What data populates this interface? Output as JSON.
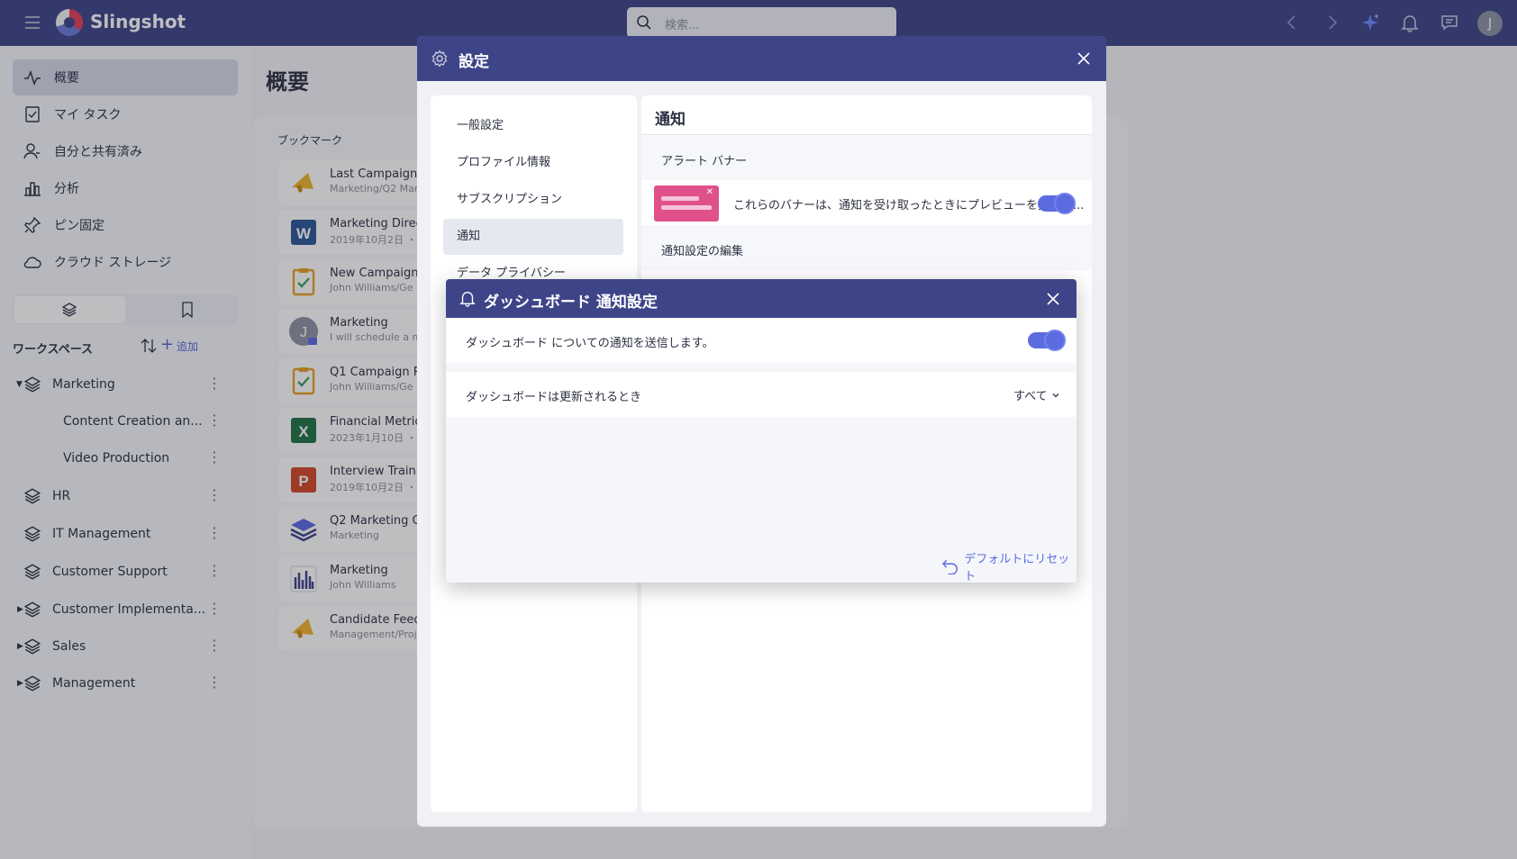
{
  "app": {
    "name": "Slingshot",
    "avatar_initial": "J"
  },
  "search": {
    "placeholder": "検索..."
  },
  "sidebar": {
    "nav": [
      {
        "label": "概要",
        "icon": "activity-icon",
        "active": true
      },
      {
        "label": "マイ タスク",
        "icon": "task-icon"
      },
      {
        "label": "自分と共有済み",
        "icon": "shared-user-icon"
      },
      {
        "label": "分析",
        "icon": "bar-chart-icon"
      },
      {
        "label": "ピン固定",
        "icon": "pin-icon"
      },
      {
        "label": "クラウド ストレージ",
        "icon": "cloud-icon"
      }
    ],
    "workspace_title": "ワークスペース",
    "add_label": "追加",
    "workspaces": [
      {
        "label": "Marketing",
        "expanded": true
      },
      {
        "label": "Content Creation an...",
        "child": true
      },
      {
        "label": "Video Production",
        "child": true
      },
      {
        "label": "HR"
      },
      {
        "label": "IT Management"
      },
      {
        "label": "Customer Support"
      },
      {
        "label": "Customer Implementa..."
      },
      {
        "label": "Sales"
      },
      {
        "label": "Management"
      }
    ]
  },
  "main": {
    "title": "概要",
    "bookmarks_title": "ブックマーク",
    "bookmarks": [
      {
        "title": "Last Campaign",
        "sub": "Marketing/Q2 Mar",
        "icon": "megaphone-icon"
      },
      {
        "title": "Marketing Direc",
        "sub": "2019年10月2日 ・",
        "icon": "word-icon"
      },
      {
        "title": "New Campaign",
        "sub": "John Williams/Ge",
        "icon": "clipboard-icon"
      },
      {
        "title": "Marketing",
        "sub": "I will schedule a m",
        "icon": "user-avatar-icon"
      },
      {
        "title": "Q1 Campaign R",
        "sub": "John Williams/Ge",
        "icon": "clipboard-icon"
      },
      {
        "title": "Financial Metric",
        "sub": "2023年1月10日 ・",
        "icon": "excel-icon"
      },
      {
        "title": "Interview Traini",
        "sub": "2019年10月2日 ・",
        "icon": "powerpoint-icon"
      },
      {
        "title": "Q2 Marketing C",
        "sub": "Marketing",
        "icon": "layers-icon"
      },
      {
        "title": "Marketing",
        "sub": "John Williams",
        "icon": "dashboard-chart-icon"
      },
      {
        "title": "Candidate Feed",
        "sub": "Management/Proj",
        "icon": "megaphone-icon"
      }
    ]
  },
  "settings": {
    "title": "設定",
    "nav": [
      {
        "label": "一般設定"
      },
      {
        "label": "プロファイル情報"
      },
      {
        "label": "サブスクリプション"
      },
      {
        "label": "通知",
        "active": true
      },
      {
        "label": "データ プライバシー"
      }
    ],
    "content_title": "通知",
    "alert_banner_label": "アラート バナー",
    "banner_desc": "これらのバナーは、通知を受け取ったときにプレビューを提供し...",
    "edit_label": "通知設定の編集"
  },
  "dialog": {
    "title": "ダッシュボード 通知設定",
    "send_label": "ダッシュボード についての通知を送信します。",
    "update_label": "ダッシュボードは更新されるとき",
    "update_value": "すべて",
    "reset_label": "デフォルトにリセット"
  },
  "colors": {
    "primary": "#3d4487",
    "accent": "#5b6ce0",
    "banner_pink": "#e0508a"
  }
}
